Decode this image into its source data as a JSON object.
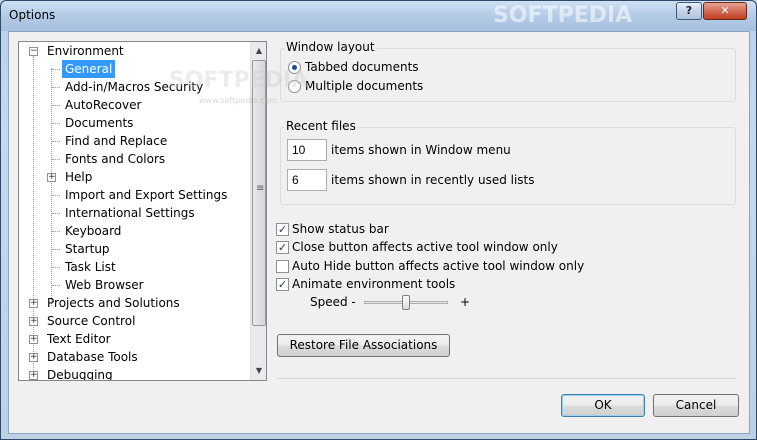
{
  "window": {
    "title": "Options"
  },
  "titlebar": {
    "help_label": "?",
    "close_label": "✕"
  },
  "tree": {
    "environment": "Environment",
    "env_children": [
      "General",
      "Add-in/Macros Security",
      "AutoRecover",
      "Documents",
      "Find and Replace",
      "Fonts and Colors",
      "Help",
      "Import and Export Settings",
      "International Settings",
      "Keyboard",
      "Startup",
      "Task List",
      "Web Browser"
    ],
    "top_level": [
      "Projects and Solutions",
      "Source Control",
      "Text Editor",
      "Database Tools",
      "Debugging"
    ],
    "selected": "General",
    "expand_plus": "+",
    "expand_minus": "−"
  },
  "window_layout": {
    "label": "Window layout",
    "tabbed": "Tabbed documents",
    "multiple": "Multiple documents",
    "selected": "Tabbed documents"
  },
  "recent_files": {
    "label": "Recent files",
    "window_menu_value": "10",
    "window_menu_label": "items shown in Window menu",
    "recent_lists_value": "6",
    "recent_lists_label": "items shown in recently used lists"
  },
  "options": {
    "show_status_bar": {
      "label": "Show status bar",
      "checked": true
    },
    "close_button": {
      "label": "Close button affects active tool window only",
      "checked": true
    },
    "auto_hide": {
      "label": "Auto Hide button affects active tool window only",
      "checked": false
    },
    "animate": {
      "label": "Animate environment tools",
      "checked": true
    },
    "speed_label": "Speed -",
    "speed_plus": "+",
    "speed_value": 0.5
  },
  "buttons": {
    "restore": "Restore File Associations",
    "ok": "OK",
    "cancel": "Cancel"
  },
  "watermark": {
    "text": "SOFTPEDIA",
    "sub": "www.softpedia.com"
  },
  "colors": {
    "selection": "#3399ff",
    "client_bg": "#f0f0f0"
  }
}
